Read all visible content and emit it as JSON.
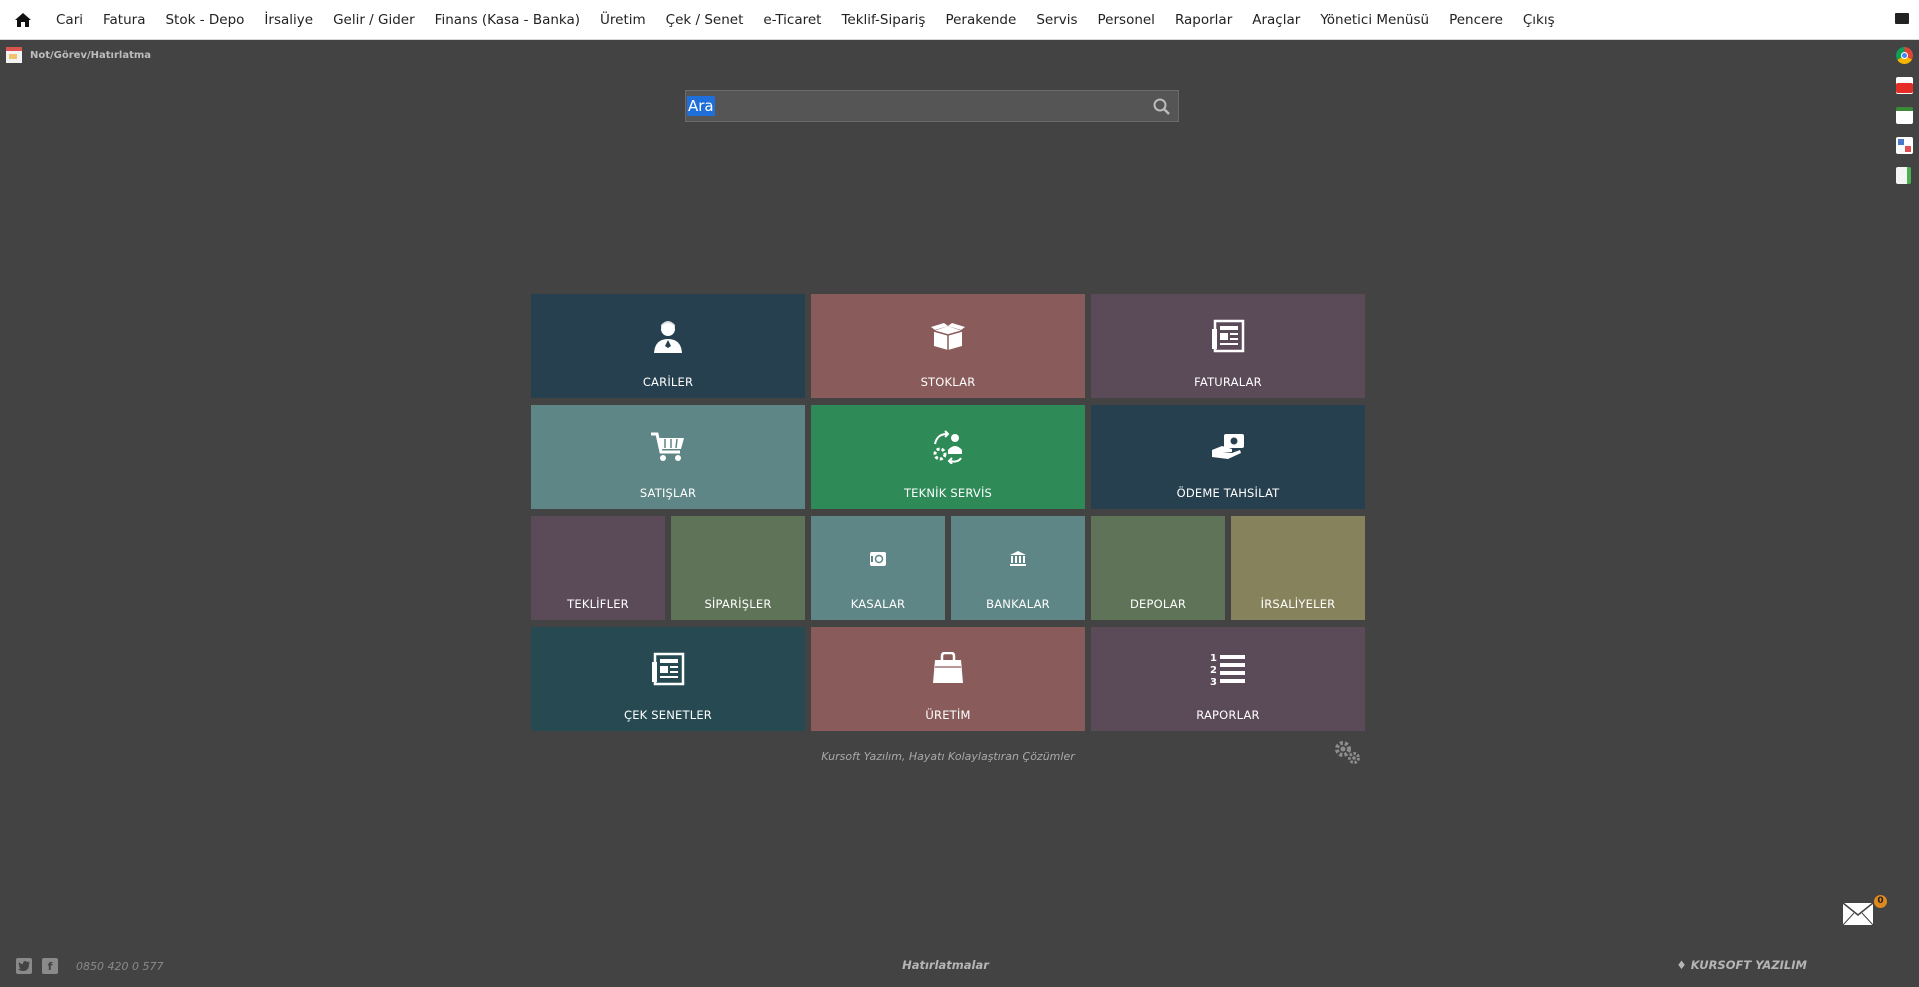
{
  "menu": {
    "items": [
      "Cari",
      "Fatura",
      "Stok - Depo",
      "İrsaliye",
      "Gelir / Gider",
      "Finans (Kasa - Banka)",
      "Üretim",
      "Çek / Senet",
      "e-Ticaret",
      "Teklif-Sipariş",
      "Perakende",
      "Servis",
      "Personel",
      "Raporlar",
      "Araçlar",
      "Yönetici Menüsü",
      "Pencere",
      "Çıkış"
    ]
  },
  "note_bar": {
    "label": "Not/Görev/Hatırlatma"
  },
  "search": {
    "value": "Ara"
  },
  "tiles": {
    "cariler": {
      "label": "CARİLER",
      "color": "#27404f"
    },
    "stoklar": {
      "label": "STOKLAR",
      "color": "#8a5b5b"
    },
    "faturalar": {
      "label": "FATURALAR",
      "color": "#5b4a58"
    },
    "satislar": {
      "label": "SATIŞLAR",
      "color": "#5f8686"
    },
    "teknik_servis": {
      "label": "TEKNİK SERVİS",
      "color": "#2e8b57"
    },
    "odeme_tahsilat": {
      "label": "ÖDEME TAHSİLAT",
      "color": "#27404f"
    },
    "teklifler": {
      "label": "TEKLİFLER",
      "color": "#5b4a58"
    },
    "siparisler": {
      "label": "SİPARİŞLER",
      "color": "#5e7358"
    },
    "kasalar": {
      "label": "KASALAR",
      "color": "#5f8686"
    },
    "bankalar": {
      "label": "BANKALAR",
      "color": "#5f8686"
    },
    "depolar": {
      "label": "DEPOLAR",
      "color": "#5e7358"
    },
    "irsaliyeler": {
      "label": "İRSALİYELER",
      "color": "#86835c"
    },
    "cek_senetler": {
      "label": "ÇEK SENETLER",
      "color": "#274a52"
    },
    "uretim": {
      "label": "ÜRETİM",
      "color": "#8a5b5b"
    },
    "raporlar": {
      "label": "RAPORLAR",
      "color": "#5b4a58"
    }
  },
  "tagline": "Kursoft Yazılım, Hayatı Kolaylaştıran Çözümler",
  "mail": {
    "badge": "0"
  },
  "footer": {
    "phone": "0850 420 0 577",
    "center": "Hatırlatmalar",
    "brand": "♦ KURSOFT YAZILIM"
  }
}
